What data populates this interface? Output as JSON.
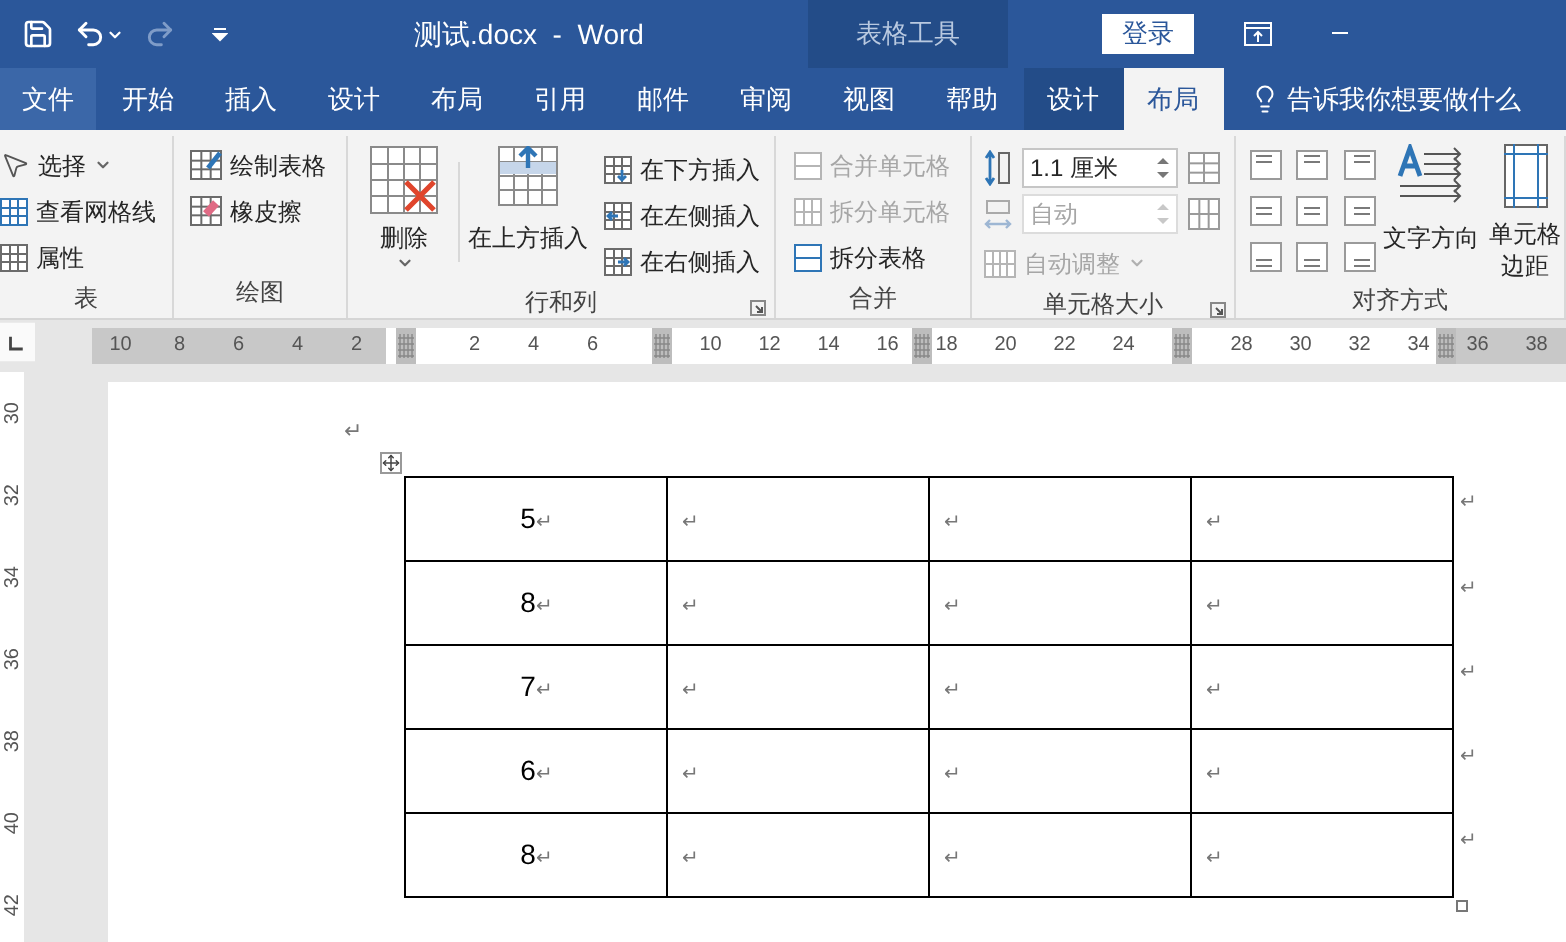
{
  "title_bar": {
    "title": "测试.docx  -  Word",
    "context_label": "表格工具",
    "login_button": "登录"
  },
  "menu_tabs": [
    {
      "label": "文件",
      "kind": "file",
      "selected": false
    },
    {
      "label": "开始",
      "kind": "normal",
      "selected": false
    },
    {
      "label": "插入",
      "kind": "normal",
      "selected": false
    },
    {
      "label": "设计",
      "kind": "normal",
      "selected": false
    },
    {
      "label": "布局",
      "kind": "normal",
      "selected": false
    },
    {
      "label": "引用",
      "kind": "normal",
      "selected": false
    },
    {
      "label": "邮件",
      "kind": "normal",
      "selected": false
    },
    {
      "label": "审阅",
      "kind": "normal",
      "selected": false
    },
    {
      "label": "视图",
      "kind": "normal",
      "selected": false
    },
    {
      "label": "帮助",
      "kind": "normal",
      "selected": false
    },
    {
      "label": "设计",
      "kind": "context",
      "selected": false
    },
    {
      "label": "布局",
      "kind": "context",
      "selected": true
    }
  ],
  "tell_me": "告诉我你想要做什么",
  "ribbon": {
    "groups": [
      {
        "kind": "table",
        "label": "表",
        "items": [
          {
            "label": "选择",
            "dropdown": true,
            "disabled": false
          },
          {
            "label": "查看网格线",
            "dropdown": false,
            "disabled": false
          },
          {
            "label": "属性",
            "dropdown": false,
            "disabled": false
          }
        ],
        "launcher": false
      },
      {
        "kind": "draw",
        "label": "绘图",
        "items": [
          {
            "label": "绘制表格",
            "dropdown": false,
            "disabled": false
          },
          {
            "label": "橡皮擦",
            "dropdown": false,
            "disabled": false
          }
        ],
        "launcher": false
      },
      {
        "kind": "rows_columns",
        "label": "行和列",
        "large_buttons": [
          {
            "label": "删除",
            "dropdown": true
          },
          {
            "label": "在上方插入",
            "dropdown": false
          }
        ],
        "items": [
          {
            "label": "在下方插入",
            "dropdown": false,
            "disabled": false
          },
          {
            "label": "在左侧插入",
            "dropdown": false,
            "disabled": false
          },
          {
            "label": "在右侧插入",
            "dropdown": false,
            "disabled": false
          }
        ],
        "launcher": true
      },
      {
        "kind": "merge",
        "label": "合并",
        "items": [
          {
            "label": "合并单元格",
            "dropdown": false,
            "disabled": true
          },
          {
            "label": "拆分单元格",
            "dropdown": false,
            "disabled": true
          },
          {
            "label": "拆分表格",
            "dropdown": false,
            "disabled": false
          }
        ],
        "launcher": false
      },
      {
        "kind": "cell_size",
        "label": "单元格大小",
        "height_field": {
          "value": "1.1 厘米",
          "disabled": false
        },
        "width_field": {
          "value": "自动",
          "disabled": true
        },
        "items": [
          {
            "label": "自动调整",
            "dropdown": true,
            "disabled": true
          }
        ],
        "launcher": true
      },
      {
        "kind": "alignment",
        "label": "对齐方式",
        "large_buttons": [
          {
            "label": "文字方向"
          },
          {
            "label": "单元格边距"
          }
        ],
        "launcher": false
      }
    ]
  },
  "horizontal_ruler": {
    "slots": [
      {
        "label": "10",
        "kind": "margin"
      },
      {
        "label": "8",
        "kind": "margin"
      },
      {
        "label": "6",
        "kind": "margin"
      },
      {
        "label": "4",
        "kind": "margin"
      },
      {
        "label": "2",
        "kind": "margin"
      },
      {
        "kind": "text"
      },
      {
        "label": "2",
        "kind": "text"
      },
      {
        "label": "4",
        "kind": "text"
      },
      {
        "label": "6",
        "kind": "text"
      },
      {
        "kind": "text"
      },
      {
        "label": "10",
        "kind": "text"
      },
      {
        "label": "12",
        "kind": "text"
      },
      {
        "label": "14",
        "kind": "text"
      },
      {
        "label": "16",
        "kind": "text"
      },
      {
        "label": "18",
        "kind": "text"
      },
      {
        "label": "20",
        "kind": "text"
      },
      {
        "label": "22",
        "kind": "text"
      },
      {
        "label": "24",
        "kind": "text"
      },
      {
        "kind": "text"
      },
      {
        "label": "28",
        "kind": "text"
      },
      {
        "label": "30",
        "kind": "text"
      },
      {
        "label": "32",
        "kind": "text"
      },
      {
        "label": "34",
        "kind": "text"
      },
      {
        "label": "36",
        "kind": "margin"
      },
      {
        "label": "38",
        "kind": "margin"
      }
    ]
  },
  "vertical_ruler": {
    "labels": [
      "30",
      "32",
      "34",
      "36",
      "38",
      "40",
      "42"
    ]
  },
  "document": {
    "paragraph_mark": "↵",
    "table": {
      "rows": [
        {
          "cells": [
            {
              "value": "5",
              "mark": "↵"
            },
            {
              "mark": "↵"
            },
            {
              "mark": "↵"
            },
            {
              "mark": "↵"
            }
          ],
          "end_mark": "↵"
        },
        {
          "cells": [
            {
              "value": "8",
              "mark": "↵"
            },
            {
              "mark": "↵"
            },
            {
              "mark": "↵"
            },
            {
              "mark": "↵"
            }
          ],
          "end_mark": "↵"
        },
        {
          "cells": [
            {
              "value": "7",
              "mark": "↵"
            },
            {
              "mark": "↵"
            },
            {
              "mark": "↵"
            },
            {
              "mark": "↵"
            }
          ],
          "end_mark": "↵"
        },
        {
          "cells": [
            {
              "value": "6",
              "mark": "↵"
            },
            {
              "mark": "↵"
            },
            {
              "mark": "↵"
            },
            {
              "mark": "↵"
            }
          ],
          "end_mark": "↵"
        },
        {
          "cells": [
            {
              "value": "8",
              "mark": "↵"
            },
            {
              "mark": "↵"
            },
            {
              "mark": "↵"
            },
            {
              "mark": "↵"
            }
          ],
          "end_mark": "↵"
        }
      ]
    }
  }
}
